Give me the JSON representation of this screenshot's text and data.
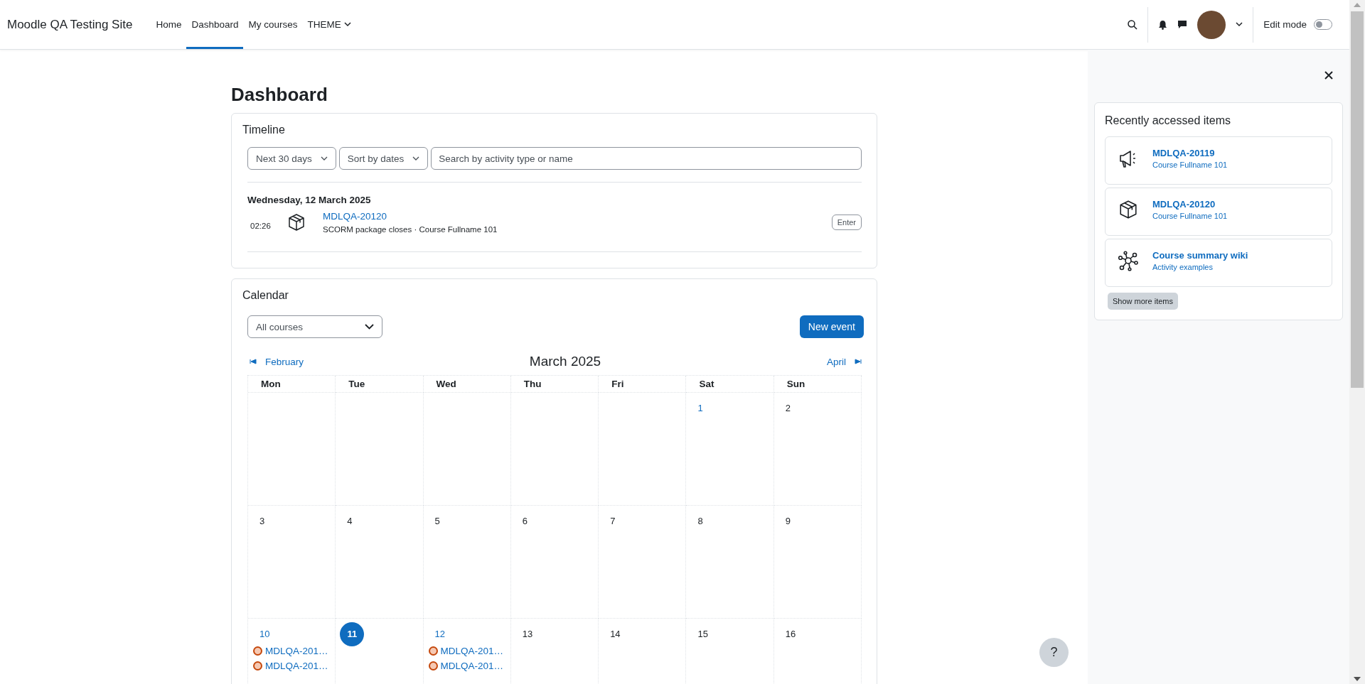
{
  "navbar": {
    "site_name": "Moodle QA Testing Site",
    "items": [
      {
        "label": "Home",
        "selected": false,
        "dropdown": false
      },
      {
        "label": "Dashboard",
        "selected": true,
        "dropdown": false
      },
      {
        "label": "My courses",
        "selected": false,
        "dropdown": false
      },
      {
        "label": "THEME",
        "selected": false,
        "dropdown": true
      }
    ],
    "edit_mode": {
      "label": "Edit mode",
      "on": false
    }
  },
  "page_title": "Dashboard",
  "timeline": {
    "title": "Timeline",
    "filter": "Next 30 days",
    "sort": "Sort by dates",
    "search": {
      "placeholder": "Search by activity type or name"
    },
    "groups": [
      {
        "date": "Wednesday, 12 March 2025",
        "events": [
          {
            "time": "02:26",
            "title": "MDLQA-20120",
            "subtitle": "SCORM package closes · Course Fullname 101",
            "action": "Enter"
          }
        ]
      }
    ]
  },
  "calendar": {
    "title": "Calendar",
    "course_filter": "All courses",
    "new_event": "New event",
    "prev": "February",
    "next": "April",
    "month": "March 2025",
    "weekdays": [
      "Mon",
      "Tue",
      "Wed",
      "Thu",
      "Fri",
      "Sat",
      "Sun"
    ],
    "weeks": [
      [
        {
          "kind": "blank"
        },
        {
          "kind": "blank"
        },
        {
          "kind": "blank"
        },
        {
          "kind": "blank"
        },
        {
          "kind": "blank"
        },
        {
          "kind": "linked",
          "label": "1"
        },
        {
          "kind": "plain",
          "label": "2"
        }
      ],
      [
        {
          "kind": "plain",
          "label": "3"
        },
        {
          "kind": "plain",
          "label": "4"
        },
        {
          "kind": "plain",
          "label": "5"
        },
        {
          "kind": "plain",
          "label": "6"
        },
        {
          "kind": "plain",
          "label": "7"
        },
        {
          "kind": "plain",
          "label": "8"
        },
        {
          "kind": "plain",
          "label": "9"
        }
      ],
      [
        {
          "kind": "linked",
          "label": "10",
          "events": [
            "MDLQA-201…",
            "MDLQA-201…"
          ]
        },
        {
          "kind": "today",
          "label": "11"
        },
        {
          "kind": "linked",
          "label": "12",
          "events": [
            "MDLQA-201…",
            "MDLQA-201…"
          ]
        },
        {
          "kind": "plain",
          "label": "13"
        },
        {
          "kind": "plain",
          "label": "14"
        },
        {
          "kind": "plain",
          "label": "15"
        },
        {
          "kind": "plain",
          "label": "16"
        }
      ]
    ]
  },
  "help_button": "?",
  "drawer": {
    "title": "Recently accessed items",
    "items": [
      {
        "kind": "announcement",
        "title": "MDLQA-20119",
        "subtitle": "Course Fullname 101"
      },
      {
        "kind": "package",
        "title": "MDLQA-20120",
        "subtitle": "Course Fullname 101"
      },
      {
        "kind": "wiki",
        "title": "Course summary wiki",
        "subtitle": "Activity examples"
      }
    ],
    "show_more": "Show more items"
  }
}
